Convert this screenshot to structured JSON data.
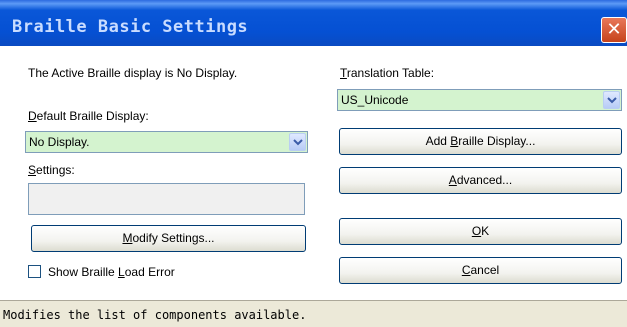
{
  "window": {
    "title": "Braille Basic Settings",
    "close_glyph": "✕"
  },
  "active_display_text": "The Active Braille display is No Display.",
  "default_display": {
    "label_key": "D",
    "label_rest": "efault Braille Display:",
    "selected": "No Display."
  },
  "settings": {
    "label_key": "S",
    "label_rest": "ettings:",
    "value": ""
  },
  "modify_button": {
    "key": "M",
    "rest": "odify Settings..."
  },
  "show_error": {
    "pre": "Show Braille ",
    "key": "L",
    "post": "oad Error",
    "checked": false
  },
  "translation": {
    "label_key": "T",
    "label_rest": "ranslation Table:",
    "selected": "US_Unicode"
  },
  "add_display_button": {
    "pre": "Add ",
    "key": "B",
    "post": "raille Display..."
  },
  "advanced_button": {
    "key": "A",
    "rest": "dvanced..."
  },
  "ok_button": {
    "key": "O",
    "rest": "K"
  },
  "cancel_button": {
    "key": "C",
    "rest": "ancel"
  },
  "status_text": "Modifies the list of components available.",
  "colors": {
    "dropdown_bg": "#d4f3cf",
    "title_bar": "#0550d3",
    "face": "#ECE9D8"
  }
}
